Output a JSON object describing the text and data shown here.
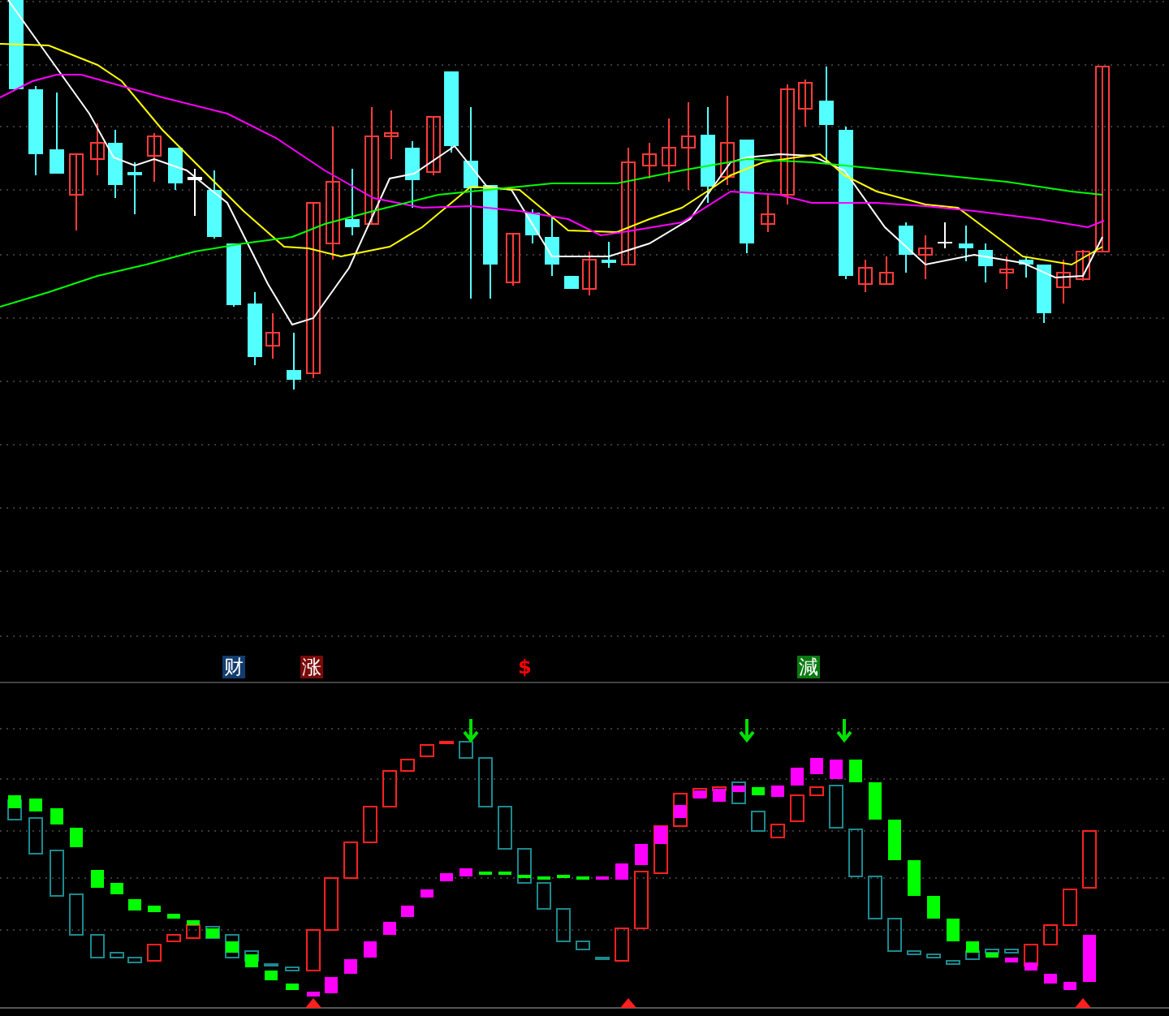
{
  "markers": [
    {
      "kind": "badge",
      "label": "财",
      "color": "#123c6e"
    },
    {
      "kind": "badge",
      "label": "涨",
      "color": "#7a0a0a"
    },
    {
      "kind": "symbol",
      "label": "$",
      "color": "#ff0000"
    },
    {
      "kind": "badge",
      "label": "減",
      "color": "#0a7a10"
    }
  ]
}
